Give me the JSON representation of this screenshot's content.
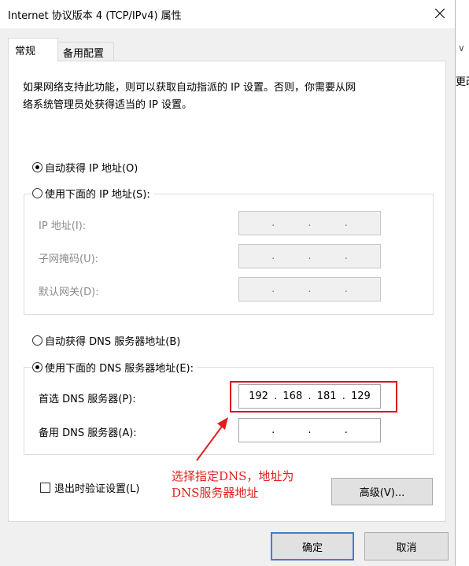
{
  "window": {
    "title": "Internet 协议版本 4 (TCP/IPv4) 属性"
  },
  "tabs": [
    {
      "label": "常规"
    },
    {
      "label": "备用配置"
    }
  ],
  "description_line1": "如果网络支持此功能，则可以获取自动指派的 IP 设置。否则，你需要从网",
  "description_line2": "络系统管理员处获得适当的 IP 设置。",
  "ip_section": {
    "auto_label": "自动获得 IP 地址(O)",
    "manual_label": "使用下面的 IP 地址(S):",
    "ip_label": "IP 地址(I):",
    "mask_label": "子网掩码(U):",
    "gateway_label": "默认网关(D):"
  },
  "dns_section": {
    "auto_label": "自动获得 DNS 服务器地址(B)",
    "manual_label": "使用下面的 DNS 服务器地址(E):",
    "preferred_label": "首选 DNS 服务器(P):",
    "preferred_octets": [
      "192",
      "168",
      "181",
      "129"
    ],
    "alternate_label": "备用 DNS 服务器(A):"
  },
  "validate_label": "退出时验证设置(L)",
  "advanced_label": "高级(V)...",
  "ok_label": "确定",
  "cancel_label": "取消",
  "annotation": {
    "line1": "选择指定DNS，地址为",
    "line2": "DNS服务器地址"
  },
  "edge": {
    "chevron": "∨",
    "partial_text": "更改"
  },
  "colors": {
    "annotation_red": "#d9141b",
    "focus_blue": "#3c7fd1"
  }
}
